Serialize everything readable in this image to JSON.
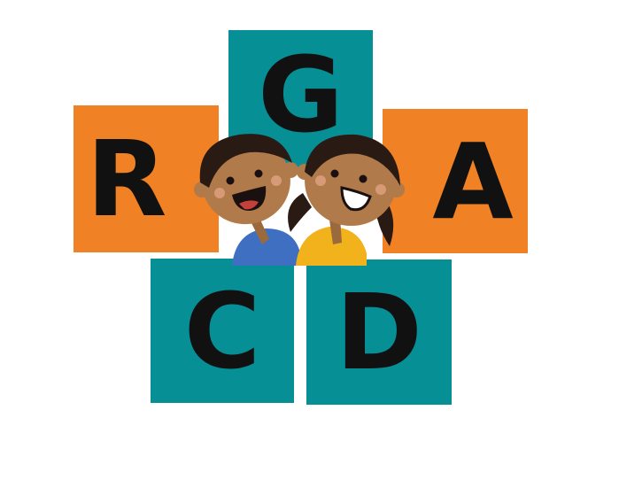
{
  "colors": {
    "orange": "#f08124",
    "teal": "#078f96",
    "letter": "#111111",
    "skin": "#b07a4a",
    "skin_shadow": "#9a6a3d",
    "hair": "#2a1a14",
    "boy_shirt": "#3f6fc0",
    "girl_shirt": "#f1b21b",
    "cheek": "#d69a77"
  },
  "tiles": {
    "g": {
      "letter": "G",
      "color": "teal"
    },
    "r": {
      "letter": "R",
      "color": "orange"
    },
    "a": {
      "letter": "A",
      "color": "orange"
    },
    "c": {
      "letter": "C",
      "color": "teal"
    },
    "d": {
      "letter": "D",
      "color": "teal"
    }
  },
  "illustration": {
    "figures": [
      "boy-figure",
      "girl-figure"
    ]
  }
}
